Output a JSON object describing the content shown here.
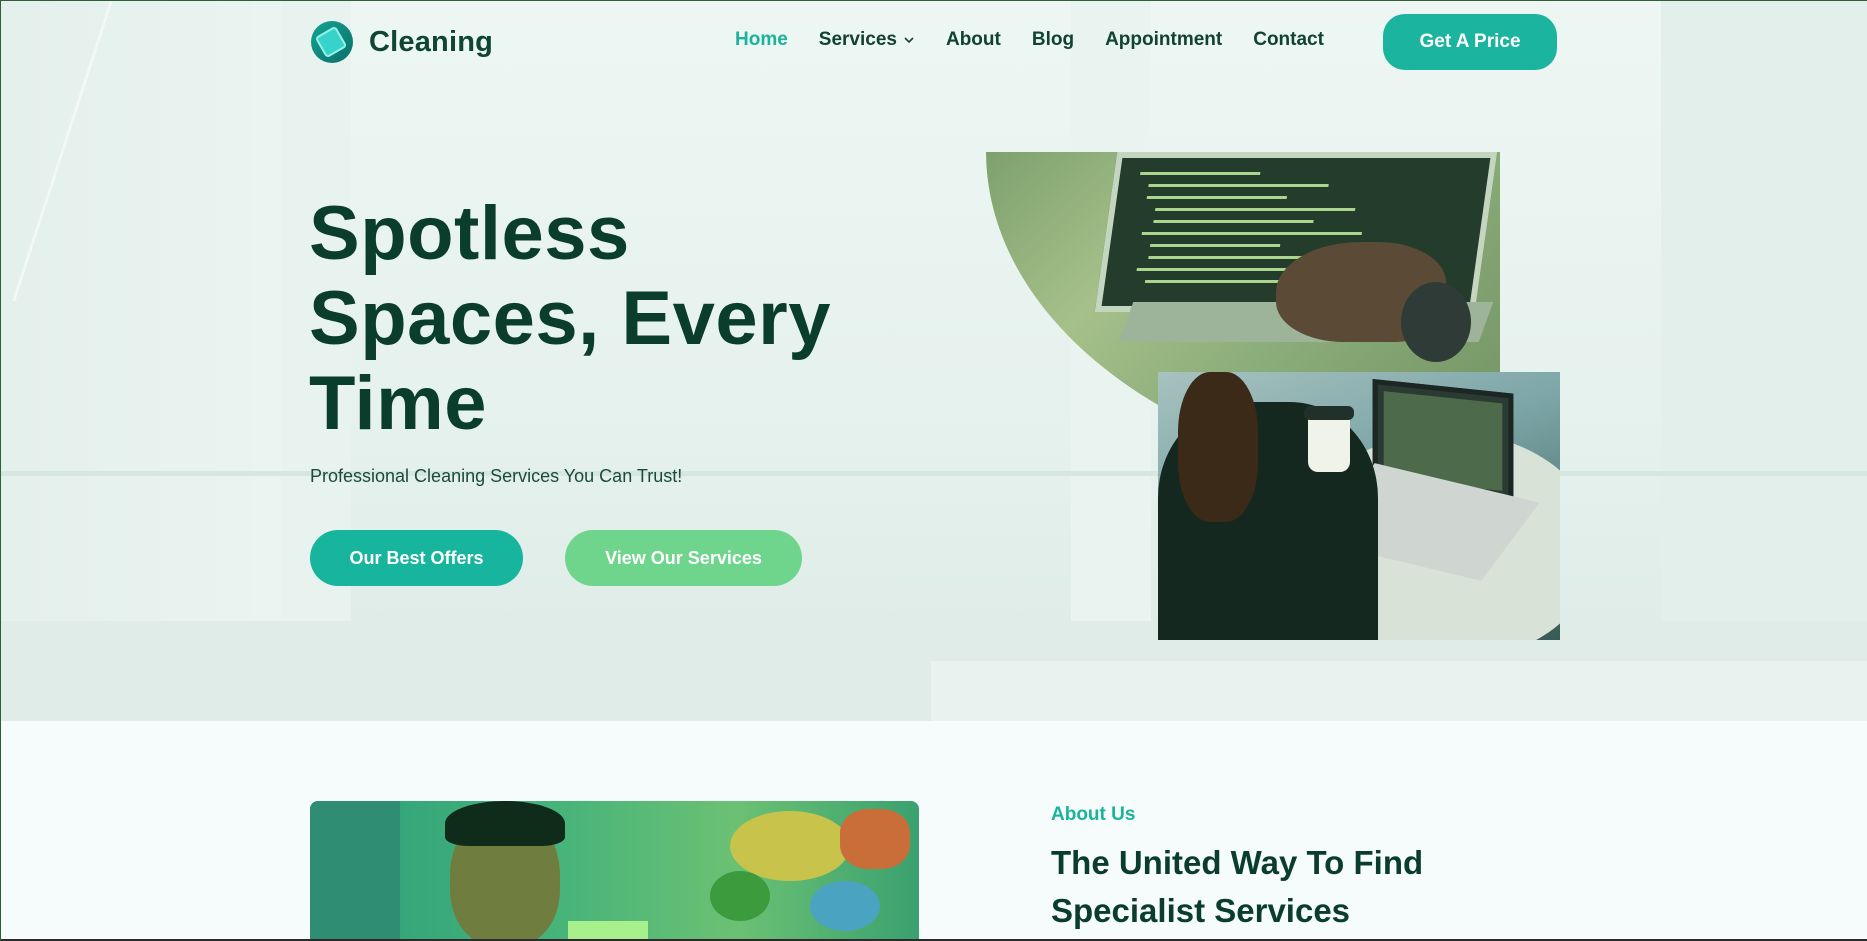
{
  "brand": {
    "name": "Cleaning",
    "logo_icon": "bucket-logo-icon"
  },
  "nav": {
    "items": [
      {
        "label": "Home",
        "active": true
      },
      {
        "label": "Services",
        "has_dropdown": true
      },
      {
        "label": "About"
      },
      {
        "label": "Blog"
      },
      {
        "label": "Appointment"
      },
      {
        "label": "Contact"
      }
    ],
    "cta_label": "Get A Price"
  },
  "hero": {
    "title_lines": [
      "Spotless",
      "Spaces, Every",
      "Time"
    ],
    "subtitle": "Professional Cleaning Services You Can Trust!",
    "primary_button": "Our Best Offers",
    "secondary_button": "View Our Services"
  },
  "about": {
    "kicker": "About Us",
    "title_lines": [
      "The United Way To Find",
      "Specialist Services"
    ]
  },
  "colors": {
    "accent": "#1bb39a",
    "accent_light": "#6fd58d",
    "heading": "#0b3d2d",
    "text": "#114232"
  }
}
